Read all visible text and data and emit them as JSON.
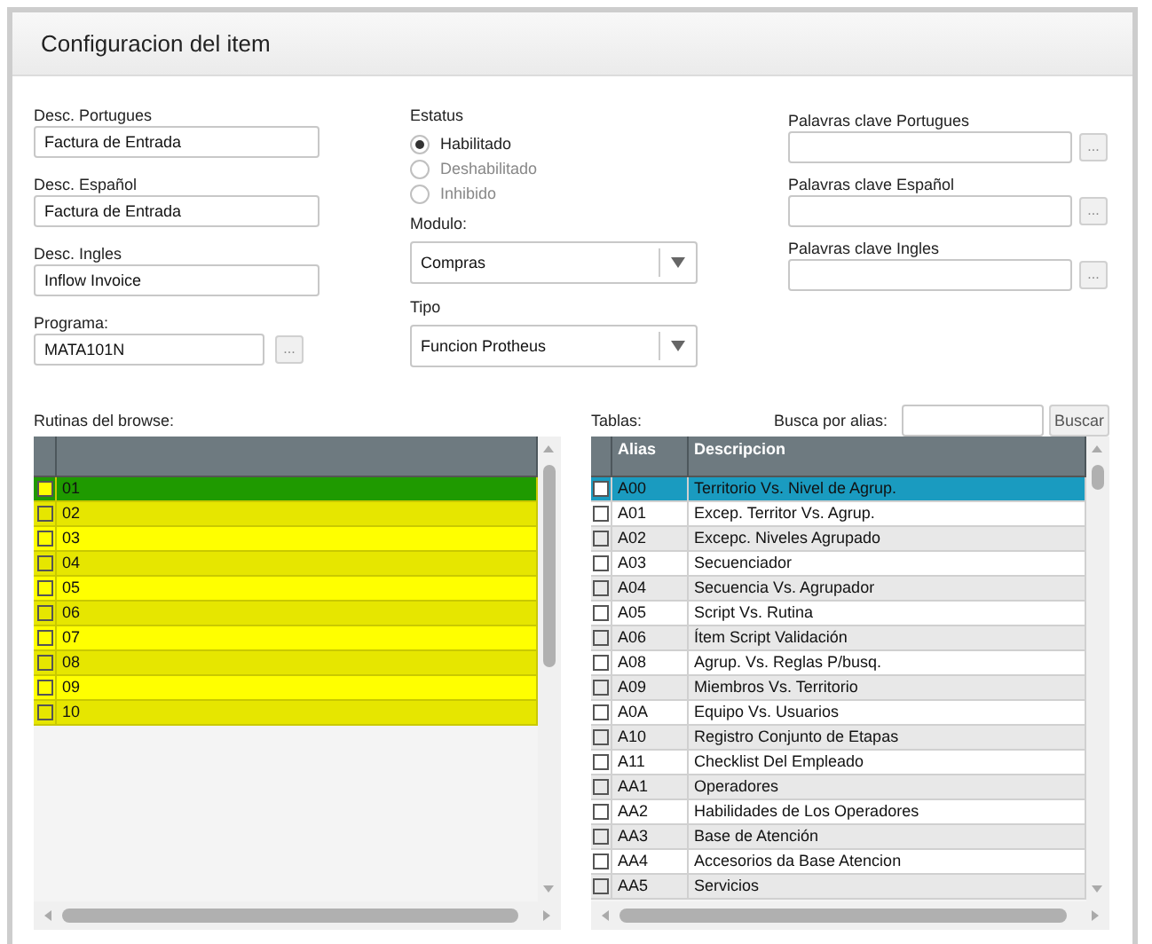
{
  "window": {
    "title": "Configuracion del item"
  },
  "descriptions": [
    {
      "label": "Desc. Portugues",
      "value": "Factura de Entrada"
    },
    {
      "label": "Desc. Español",
      "value": "Factura de Entrada"
    },
    {
      "label": "Desc. Ingles",
      "value": "Inflow Invoice"
    },
    {
      "label": "Programa:",
      "value": "MATA101N",
      "lookup": "..."
    }
  ],
  "status": {
    "label": "Estatus",
    "options": [
      {
        "label": "Habilitado",
        "selected": true
      },
      {
        "label": "Deshabilitado",
        "selected": false
      },
      {
        "label": "Inhibido",
        "selected": false
      }
    ]
  },
  "selects": [
    {
      "label": "Modulo:",
      "value": "Compras"
    },
    {
      "label": "Tipo",
      "value": "Funcion Protheus"
    }
  ],
  "keywords": [
    {
      "label": "Palavras clave Portugues",
      "lookup": "..."
    },
    {
      "label": "Palavras clave Español",
      "lookup": "..."
    },
    {
      "label": "Palavras clave Ingles",
      "lookup": "..."
    }
  ],
  "browse": {
    "label": "Rutinas del browse:",
    "rows": [
      {
        "cells": [
          "01"
        ],
        "checked": false,
        "selected": true
      },
      {
        "cells": [
          "02"
        ],
        "checked": false,
        "selected": false
      },
      {
        "cells": [
          "03"
        ],
        "checked": false,
        "selected": false
      },
      {
        "cells": [
          "04"
        ],
        "checked": false,
        "selected": false
      },
      {
        "cells": [
          "05"
        ],
        "checked": false,
        "selected": false
      },
      {
        "cells": [
          "06"
        ],
        "checked": false,
        "selected": false
      },
      {
        "cells": [
          "07"
        ],
        "checked": false,
        "selected": false
      },
      {
        "cells": [
          "08"
        ],
        "checked": false,
        "selected": false
      },
      {
        "cells": [
          "09"
        ],
        "checked": false,
        "selected": false
      },
      {
        "cells": [
          "10"
        ],
        "checked": false,
        "selected": false
      }
    ]
  },
  "tables": {
    "label": "Tablas:",
    "search_label": "Busca por alias:",
    "search_button": "Buscar",
    "columns": [
      "Alias",
      "Descripcion"
    ],
    "rows": [
      {
        "cells": [
          "A00",
          "Territorio Vs. Nivel de Agrup."
        ],
        "checked": false,
        "selected": true
      },
      {
        "cells": [
          "A01",
          "Excep. Territor Vs. Agrup."
        ],
        "checked": false,
        "selected": false
      },
      {
        "cells": [
          "A02",
          "Excepc. Niveles Agrupado"
        ],
        "checked": false,
        "selected": false
      },
      {
        "cells": [
          "A03",
          "Secuenciador"
        ],
        "checked": false,
        "selected": false
      },
      {
        "cells": [
          "A04",
          "Secuencia Vs. Agrupador"
        ],
        "checked": false,
        "selected": false
      },
      {
        "cells": [
          "A05",
          "Script Vs. Rutina"
        ],
        "checked": false,
        "selected": false
      },
      {
        "cells": [
          "A06",
          "Ítem Script Validación"
        ],
        "checked": false,
        "selected": false
      },
      {
        "cells": [
          "A08",
          "Agrup. Vs. Reglas P/busq."
        ],
        "checked": false,
        "selected": false
      },
      {
        "cells": [
          "A09",
          "Miembros Vs. Territorio"
        ],
        "checked": false,
        "selected": false
      },
      {
        "cells": [
          "A0A",
          "Equipo Vs. Usuarios"
        ],
        "checked": false,
        "selected": false
      },
      {
        "cells": [
          "A10",
          "Registro Conjunto de Etapas"
        ],
        "checked": false,
        "selected": false
      },
      {
        "cells": [
          "A11",
          "Checklist Del Empleado"
        ],
        "checked": false,
        "selected": false
      },
      {
        "cells": [
          "AA1",
          "Operadores"
        ],
        "checked": false,
        "selected": false
      },
      {
        "cells": [
          "AA2",
          "Habilidades de Los Operadores"
        ],
        "checked": false,
        "selected": false
      },
      {
        "cells": [
          "AA3",
          "Base de Atención"
        ],
        "checked": false,
        "selected": false
      },
      {
        "cells": [
          "AA4",
          "Accesorios da Base Atencion"
        ],
        "checked": false,
        "selected": false
      },
      {
        "cells": [
          "AA5",
          "Servicios"
        ],
        "checked": false,
        "selected": false
      }
    ]
  }
}
